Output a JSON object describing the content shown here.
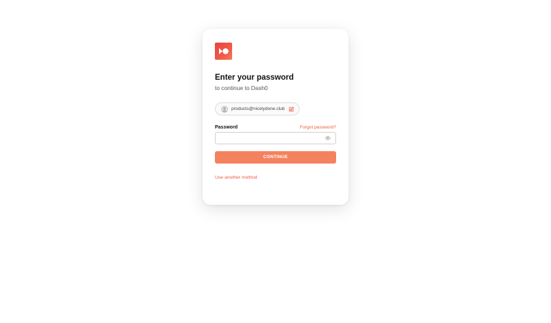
{
  "brand": {
    "logo_icon": "dash0-logo-icon",
    "gradient": [
      "#e8443f",
      "#f47a5c"
    ]
  },
  "header": {
    "title": "Enter your password",
    "subtitle": "to continue to Dash0"
  },
  "identity": {
    "avatar_icon": "user-avatar-icon",
    "email": "products@nicelydone.club",
    "edit_icon": "pencil-edit-icon"
  },
  "password": {
    "label": "Password",
    "forgot_link": "Forgot password?",
    "value": "",
    "placeholder": "",
    "visibility_icon": "eye-icon"
  },
  "actions": {
    "continue_label": "CONTINUE",
    "another_method_link": "Use another method"
  },
  "colors": {
    "accent": "#ec5b3f",
    "button": "#f4825f",
    "text": "#111111"
  }
}
